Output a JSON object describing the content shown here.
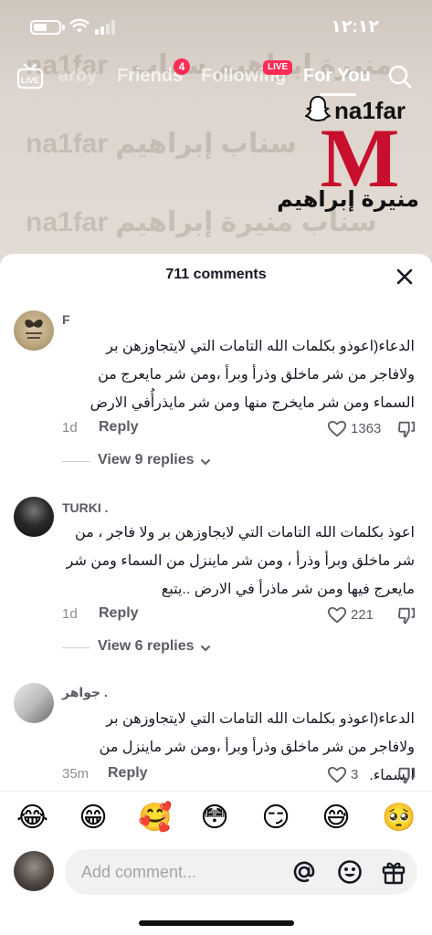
{
  "status_bar": {
    "time": "١٢:١٢"
  },
  "top_nav": {
    "tabs": [
      "arby",
      "Friends",
      "Following",
      "For You"
    ],
    "friends_badge": "4",
    "following_badge": "LIVE",
    "live_label": "LIVE"
  },
  "video": {
    "brand_name": "na1far",
    "brand_letter": "M",
    "brand_arabic": "منيرة إبراهيم",
    "watermark_top": "na1far , منيرة إبراهيم سناب",
    "watermark_mid": "na1far سناب إبراهيم",
    "watermark_bottom": "na1far سناب منيرة إبراهيم"
  },
  "sheet": {
    "title": "711 comments"
  },
  "comments": [
    {
      "username": "F",
      "text": "الدعاء(اعوذو بكلمات الله التامات التي لايتجاوزهن بر ولافاجر من شر ماخلق وذرأ وبرأ ،ومن شر مايعرج من السماء ومن شر مايخرج منها ومن شر مايذرأُفي الارض",
      "time": "1d",
      "reply": "Reply",
      "likes": "1363",
      "view_replies": "View 9 replies"
    },
    {
      "username": "TURKI .",
      "text": "اعوذ بكلمات الله التامات التي لايجاوزهن بر ولا فاجر ، من شر ماخلق وبرأ وذرأ ، ومن شر ماينزل من السماء ومن شر مايعرج فيها ومن شر ماذرأ في الارض ..يتبع",
      "time": "1d",
      "reply": "Reply",
      "likes": "221",
      "view_replies": "View 6 replies"
    },
    {
      "username": "جواهر .",
      "text": "الدعاء(اعوذو بكلمات الله التامات التي لايتجاوزهن بر ولافاجر من شر ماخلق وذرأ وبرأ ،ومن شر ماينزل من السماء.",
      "time": "35m",
      "reply": "Reply",
      "likes": "3"
    }
  ],
  "emojis": [
    "😂",
    "😁",
    "🥰",
    "😳",
    "😏",
    "😅",
    "🥺"
  ],
  "input": {
    "placeholder": "Add comment..."
  },
  "colors": {
    "accent": "#fe2c55",
    "brand_red": "#c8102e"
  }
}
